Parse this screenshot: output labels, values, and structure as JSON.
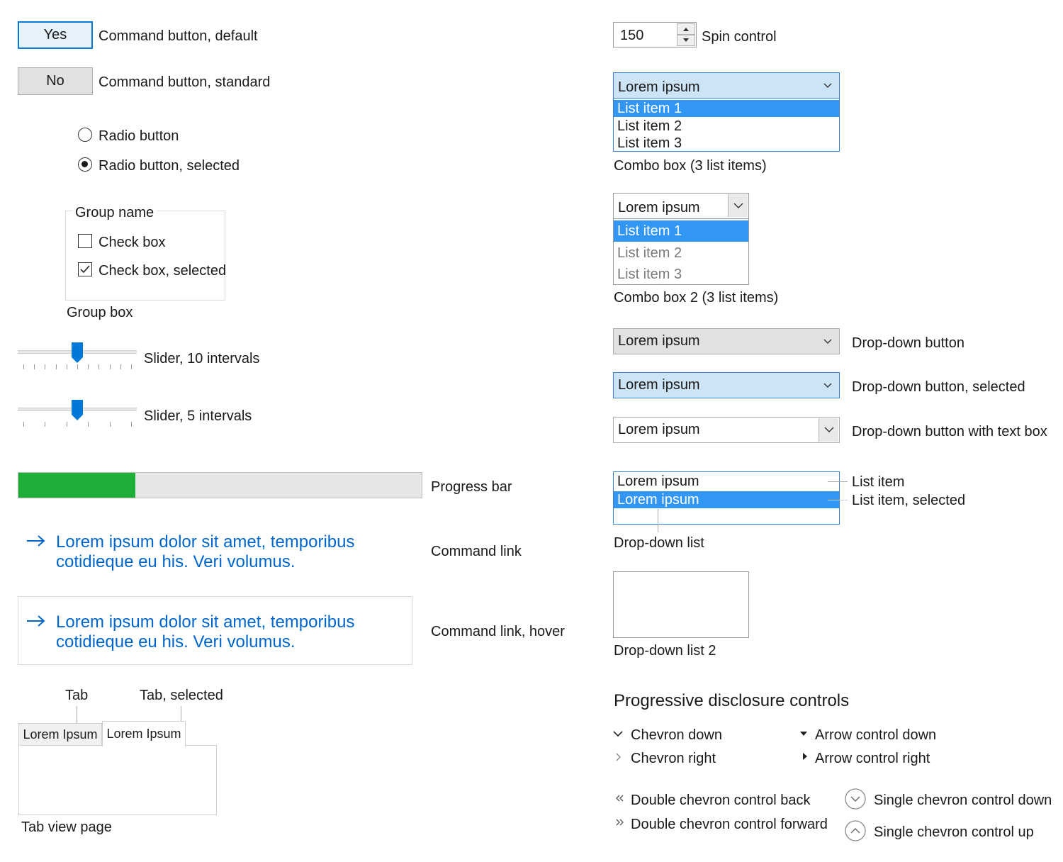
{
  "buttons": {
    "yes": {
      "label": "Yes",
      "caption": "Command button, default"
    },
    "no": {
      "label": "No",
      "caption": "Command button, standard"
    }
  },
  "radios": {
    "unselected": "Radio button",
    "selected": "Radio button, selected"
  },
  "group": {
    "name": "Group name",
    "check": "Check box",
    "check_selected": "Check box, selected",
    "caption": "Group box"
  },
  "sliders": {
    "ten": {
      "caption": "Slider, 10 intervals",
      "ticks": 10,
      "value": 0.5
    },
    "five": {
      "caption": "Slider, 5 intervals",
      "ticks": 5,
      "value": 0.5
    }
  },
  "progress": {
    "caption": "Progress bar",
    "value": 0.29,
    "color": "#1fae37"
  },
  "command_links": {
    "normal": {
      "line1": "Lorem ipsum dolor sit amet, temporibus",
      "line2": "cotidieque eu his. Veri volumus.",
      "caption": "Command link"
    },
    "hover": {
      "line1": "Lorem ipsum dolor sit amet, temporibus",
      "line2": "cotidieque eu his. Veri volumus.",
      "caption": "Command link, hover"
    }
  },
  "tabs": {
    "tab_caption": "Tab",
    "tab_selected_caption": "Tab, selected",
    "tab1": "Lorem Ipsum",
    "tab2": "Lorem Ipsum",
    "page_caption": "Tab view page"
  },
  "spin": {
    "value": "150",
    "caption": "Spin control"
  },
  "combo1": {
    "value": "Lorem ipsum",
    "items": [
      "List item 1",
      "List item 2",
      "List item 3"
    ],
    "caption": "Combo box (3 list items)"
  },
  "combo2": {
    "value": "Lorem ipsum",
    "items": [
      "List item 1",
      "List item 2",
      "List item 3"
    ],
    "caption": "Combo box 2 (3 list items)"
  },
  "dropdowns": {
    "button": {
      "value": "Lorem ipsum",
      "caption": "Drop-down button"
    },
    "button_selected": {
      "value": "Lorem ipsum",
      "caption": "Drop-down button, selected"
    },
    "button_textbox": {
      "value": "Lorem ipsum",
      "caption": "Drop-down button with text box"
    }
  },
  "dropdown_list": {
    "item": "Lorem ipsum",
    "item_selected": "Lorem ipsum",
    "item_caption": "List item",
    "item_selected_caption": "List item, selected",
    "caption": "Drop-down list",
    "caption2": "Drop-down list 2"
  },
  "disclosure": {
    "title": "Progressive disclosure controls",
    "chevron_down": "Chevron down",
    "chevron_right": "Chevron right",
    "arrow_down": "Arrow control down",
    "arrow_right": "Arrow control right",
    "double_back": "Double chevron control back",
    "double_forward": "Double chevron control forward",
    "single_down": "Single chevron control down",
    "single_up": "Single chevron control up"
  },
  "colors": {
    "accent": "#0078d7",
    "selection": "#3296f4",
    "link": "#0066cc",
    "progress_fill": "#1fae37"
  }
}
